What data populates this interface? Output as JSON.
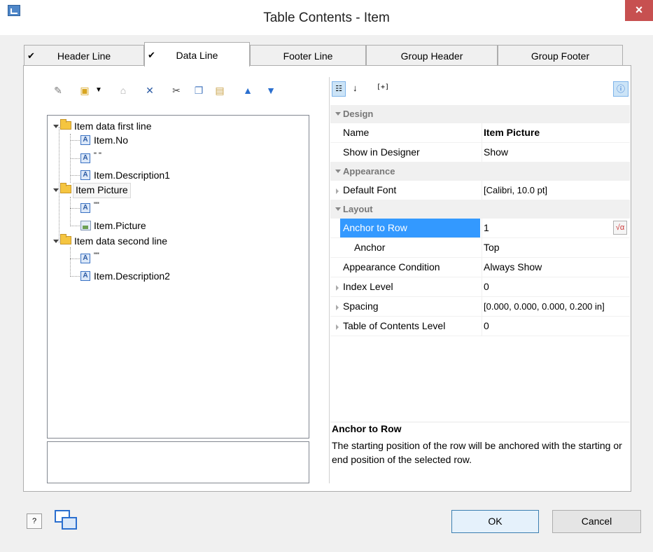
{
  "window": {
    "title": "Table Contents - Item",
    "close_glyph": "×"
  },
  "tabs": [
    {
      "label": "Header Line",
      "checked": true
    },
    {
      "label": "Data Line",
      "checked": true
    },
    {
      "label": "Footer Line",
      "checked": false
    },
    {
      "label": "Group Header",
      "checked": false
    },
    {
      "label": "Group Footer",
      "checked": false
    }
  ],
  "check_glyph": "✔",
  "tree": {
    "nodes": [
      {
        "label": "Item data first line"
      },
      {
        "label": "Item.No"
      },
      {
        "label": "\" \""
      },
      {
        "label": "Item.Description1"
      },
      {
        "label": "Item Picture"
      },
      {
        "label": "\"\""
      },
      {
        "label": "Item.Picture"
      },
      {
        "label": "Item data second line"
      },
      {
        "label": "\"\""
      },
      {
        "label": "Item.Description2"
      }
    ]
  },
  "properties": {
    "categories": {
      "design": "Design",
      "appearance": "Appearance",
      "layout": "Layout"
    },
    "rows": [
      {
        "name": "Name",
        "value": "Item Picture"
      },
      {
        "name": "Show in Designer",
        "value": "Show"
      },
      {
        "name": "Default Font",
        "value": "[Calibri, 10.0 pt]"
      },
      {
        "name": "Anchor to Row",
        "value": "1"
      },
      {
        "name": "Anchor",
        "value": "Top"
      },
      {
        "name": "Appearance Condition",
        "value": "Always Show"
      },
      {
        "name": "Index Level",
        "value": "0"
      },
      {
        "name": "Spacing",
        "value": "[0.000, 0.000, 0.000, 0.200 in]"
      },
      {
        "name": "Table of Contents Level",
        "value": "0"
      }
    ],
    "sort_label": "[+]",
    "formula_glyph": "√α"
  },
  "description": {
    "title": "Anchor to Row",
    "text": "The starting position of the row will be anchored with the starting or end position of the selected row."
  },
  "buttons": {
    "ok": "OK",
    "cancel": "Cancel",
    "help": "?"
  },
  "colors": {
    "selection": "#3399ff",
    "close": "#c75050",
    "folder": "#f5c540"
  }
}
